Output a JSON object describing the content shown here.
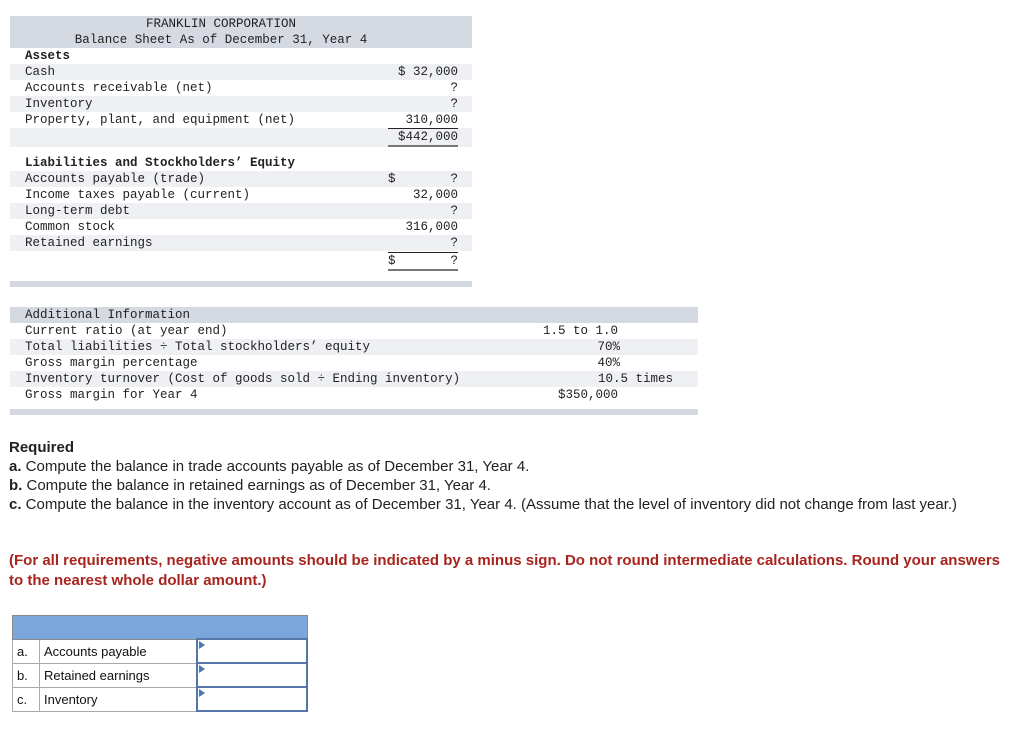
{
  "balance_sheet": {
    "company": "FRANKLIN CORPORATION",
    "subtitle": "Balance Sheet As of December 31, Year 4",
    "assets_heading": "Assets",
    "assets": [
      {
        "label": "Cash",
        "currency": "$",
        "value": "32,000"
      },
      {
        "label": "Accounts receivable (net)",
        "currency": "",
        "value": "?"
      },
      {
        "label": "Inventory",
        "currency": "",
        "value": "?"
      },
      {
        "label": "Property, plant, and equipment (net)",
        "currency": "",
        "value": "310,000"
      }
    ],
    "assets_total": "$442,000",
    "liab_heading": "Liabilities and Stockholders’ Equity",
    "liabilities": [
      {
        "label": "Accounts payable (trade)",
        "currency": "$",
        "value": "?"
      },
      {
        "label": "Income taxes payable (current)",
        "currency": "",
        "value": "32,000"
      },
      {
        "label": "Long-term debt",
        "currency": "",
        "value": "?"
      },
      {
        "label": "Common stock",
        "currency": "",
        "value": "316,000"
      },
      {
        "label": "Retained earnings",
        "currency": "",
        "value": "?"
      }
    ],
    "liab_total_currency": "$",
    "liab_total_value": "?"
  },
  "additional_info": {
    "heading": "Additional Information",
    "items": [
      {
        "label": "Current ratio (at year end)",
        "value": "1.5 to 1.0"
      },
      {
        "label": "Total liabilities ÷ Total stockholders’ equity",
        "value": "70%"
      },
      {
        "label": "Gross margin percentage",
        "value": "40%"
      },
      {
        "label": "Inventory turnover (Cost of goods sold ÷ Ending inventory)",
        "value": "10.5 times"
      },
      {
        "label": "Gross margin for Year 4",
        "value": "$350,000"
      }
    ]
  },
  "required": {
    "title": "Required",
    "items": [
      {
        "letter": "a.",
        "text": " Compute the balance in trade accounts payable as of December 31, Year 4."
      },
      {
        "letter": "b.",
        "text": " Compute the balance in retained earnings as of December 31, Year 4."
      },
      {
        "letter": "c.",
        "text": " Compute the balance in the inventory account as of December 31, Year 4. (Assume that the level of inventory did not change from last year.)"
      }
    ],
    "note": "(For all requirements, negative amounts should be indicated by a minus sign. Do not round intermediate calculations. Round your answers to the nearest whole dollar amount.)"
  },
  "answer_table": {
    "rows": [
      {
        "letter": "a.",
        "label": "Accounts payable",
        "value": ""
      },
      {
        "letter": "b.",
        "label": "Retained earnings",
        "value": ""
      },
      {
        "letter": "c.",
        "label": "Inventory",
        "value": ""
      }
    ]
  }
}
